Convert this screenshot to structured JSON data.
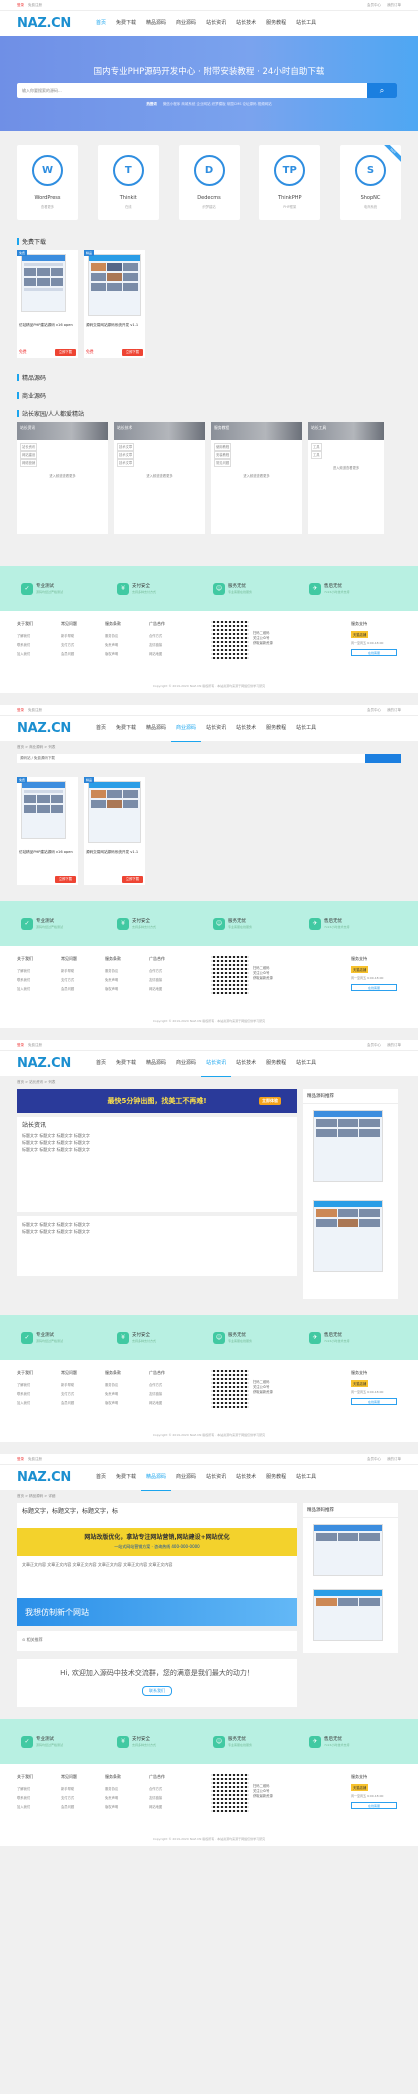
{
  "topbar": {
    "left": [
      "您好，请",
      "登录",
      "免费注册"
    ],
    "right": [
      "会员中心",
      "我的订单"
    ]
  },
  "nav": {
    "logo_a": "NAZ",
    "logo_b": ".CN",
    "items": [
      "首页",
      "免费下载",
      "精品源码",
      "商业源码",
      "站长资讯",
      "站长技术",
      "服务教程",
      "站长工具"
    ]
  },
  "hero": {
    "title": "国内专业PHP源码开发中心 · 附带安装教程 · 24小时自助下载",
    "search_placeholder": "输入你要搜索的源码...",
    "hot_label": "热搜词",
    "hot": "微信小程序 商城系统 企业网站 织梦模板 帝国CMS 论坛源码 视频网站"
  },
  "cats": [
    {
      "name": "WordPress",
      "sub": "查看更多",
      "icon": "W"
    },
    {
      "name": "Thinkit",
      "sub": "在线",
      "icon": "T"
    },
    {
      "name": "Dedecms",
      "sub": "织梦建站",
      "icon": "D"
    },
    {
      "name": "ThinkPHP",
      "sub": "PHP框架",
      "icon": "TP"
    },
    {
      "name": "ShopNC",
      "sub": "电商系统",
      "icon": "S",
      "ribbon": "HOT"
    }
  ],
  "sections": {
    "free": "免费下载",
    "boutique": "精品源码",
    "business": "商业源码",
    "wiki": "站长家园/人人都爱精站"
  },
  "products": [
    {
      "tag": "免费",
      "title": "仿站精品PHP建站源码 v16 open",
      "price": "免费",
      "btn": "立即下载"
    },
    {
      "tag": "精品",
      "title": "源码交易网站源码系统开发 v1.1",
      "price": "免费",
      "btn": "立即下载"
    }
  ],
  "wiki": [
    {
      "head": "站长资讯",
      "rows": [
        "站长资讯",
        "网站建设",
        "网络营销"
      ],
      "more": "进入频道查看更多"
    },
    {
      "head": "站长技术",
      "rows": [
        "技术文章",
        "技术文章",
        "技术文章"
      ],
      "more": "进入频道查看更多"
    },
    {
      "head": "服务教程",
      "rows": [
        "使用教程",
        "安装教程",
        "常见问题"
      ],
      "more": "进入频道查看更多"
    },
    {
      "head": "站长工具",
      "rows": [
        "工具",
        "工具"
      ],
      "more": "进入频道查看更多"
    }
  ],
  "features": [
    {
      "icon": "✓",
      "title": "专业测试",
      "desc": "源码均经过严格测试"
    },
    {
      "icon": "¥",
      "title": "支付安全",
      "desc": "支持多种支付方式"
    },
    {
      "icon": "☺",
      "title": "服务无忧",
      "desc": "专业客服在线服务"
    },
    {
      "icon": "✈",
      "title": "售后无忧",
      "desc": "7x24小时技术支持"
    }
  ],
  "footer": {
    "cols": [
      {
        "h": "关于我们",
        "items": [
          "了解我们",
          "联系我们",
          "加入我们"
        ]
      },
      {
        "h": "常见问题",
        "items": [
          "新手帮助",
          "支付方式",
          "会员问题"
        ]
      },
      {
        "h": "服务条款",
        "items": [
          "服务协议",
          "免责声明",
          "版权声明"
        ]
      },
      {
        "h": "广告合作",
        "items": [
          "合作方式",
          "友情链接",
          "网站地图"
        ]
      }
    ],
    "qr_text": "扫码二维码\n关注公众号\n获取最新资源",
    "right_h": "服务支持",
    "badge": "天猫店铺",
    "support": "周一至周五 9:00-18:00",
    "online": "在线客服",
    "copy": "Copyright © 2019-2020 NAZ.CN 版权所有 · 本站资源均来源于网络仅供学习研究"
  },
  "page2": {
    "crumb": "首页 > 商业源码 > 列表",
    "search_placeholder": "源码站 / 免费源码下载"
  },
  "page3": {
    "crumb": "首页 > 站长资讯 > 列表",
    "ad": "最快5分钟出图，找美工不再难!",
    "ad_cta": "立即体验",
    "article_title": "站长资讯",
    "list_text": "标题文字 标题文字 标题文字 标题文字",
    "side_head": "精品源码推荐"
  },
  "page4": {
    "crumb": "首页 > 精品源码 > 详细",
    "title": "标题文字，标题文字，标题文字，标",
    "banner1": "网站改版优化，拿站专注网站营销,网站建设+网站优化",
    "banner1_sub": "一站式网站营销方案 · 咨询热线 400-000-0000",
    "body": "文章正文内容 文章正文内容 文章正文内容 文章正文内容 文章正文内容 文章正文内容",
    "banner2": "我想仿制新个网站",
    "related": "相关推荐",
    "greet": "Hi, 欢迎加入源码中技术交流群，您的满意是我们最大的动力！",
    "greet_btn": "联系我们"
  }
}
